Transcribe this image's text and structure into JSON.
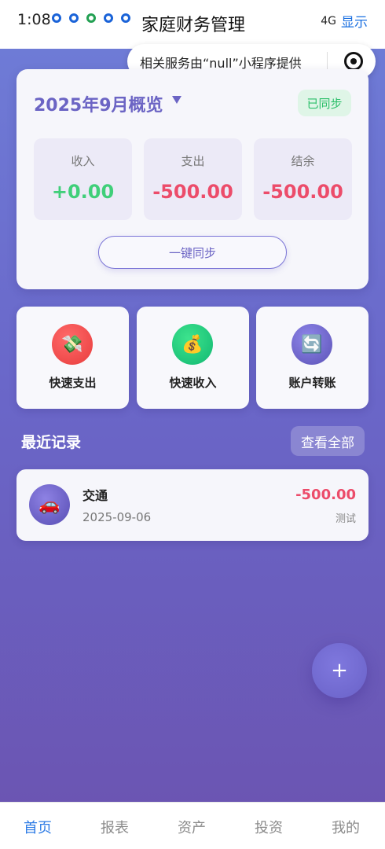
{
  "status_bar": {
    "time": "1:08",
    "app_title": "家庭财务管理",
    "right_text": "显示",
    "signal": "4G"
  },
  "capsule": {
    "text": "相关服务由“null”小程序提供"
  },
  "overview": {
    "title": "2025年9月概览",
    "badge": "已同步",
    "stats": [
      {
        "label": "收入",
        "value": "+0.00",
        "color": "#3fcf79"
      },
      {
        "label": "支出",
        "value": "-500.00",
        "color": "#ec4c6a"
      },
      {
        "label": "结余",
        "value": "-500.00",
        "color": "#ec4c6a"
      }
    ],
    "sync_button": "一键同步"
  },
  "quick_actions": [
    {
      "label": "快速支出",
      "icon": "money-wings-icon",
      "glyph": "💸"
    },
    {
      "label": "快速收入",
      "icon": "money-bag-icon",
      "glyph": "💰"
    },
    {
      "label": "账户转账",
      "icon": "refresh-icon",
      "glyph": "🔄"
    }
  ],
  "recent": {
    "title": "最近记录",
    "view_all": "查看全部",
    "records": [
      {
        "category": "交通",
        "date": "2025-09-06",
        "amount": "-500.00",
        "note": "测试",
        "icon": "car-icon",
        "glyph": "🚗"
      }
    ]
  },
  "fab": {
    "icon": "plus-icon",
    "glyph": "+"
  },
  "tabbar": {
    "tabs": [
      {
        "label": "首页",
        "active": true
      },
      {
        "label": "报表",
        "active": false
      },
      {
        "label": "资产",
        "active": false
      },
      {
        "label": "投资",
        "active": false
      },
      {
        "label": "我的",
        "active": false
      }
    ]
  },
  "colors": {
    "accent": "#6b64c4",
    "income": "#3fcf79",
    "expense": "#ec4c6a",
    "tab_active": "#2d7be5"
  }
}
